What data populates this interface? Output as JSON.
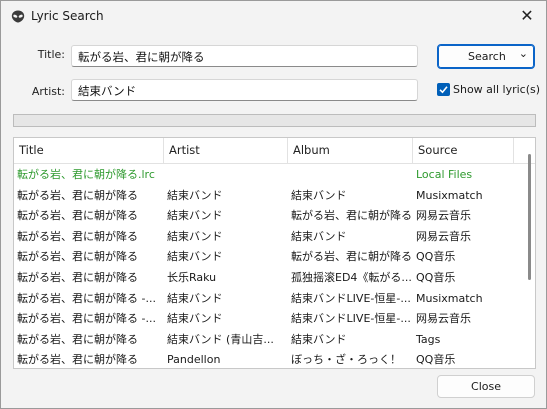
{
  "window": {
    "title": "Lyric Search",
    "close_glyph": "✕",
    "icon": "alien-icon"
  },
  "form": {
    "title_label": "Title:",
    "title_value": "転がる岩、君に朝が降る",
    "artist_label": "Artist:",
    "artist_value": "結束バンド",
    "search_label": "Search",
    "search_dropdown_glyph": "⌄",
    "show_all_label": "Show all lyric(s)",
    "show_all_checked": true
  },
  "progress": {
    "value": 0
  },
  "table": {
    "columns": [
      "Title",
      "Artist",
      "Album",
      "Source"
    ],
    "rows": [
      {
        "title": "転がる岩、君に朝が降る.lrc",
        "artist": "",
        "album": "",
        "source": "Local Files",
        "local": true
      },
      {
        "title": "転がる岩、君に朝が降る",
        "artist": "結束バンド",
        "album": "結束バンド",
        "source": "Musixmatch",
        "local": false
      },
      {
        "title": "転がる岩、君に朝が降る",
        "artist": "結束バンド",
        "album": "転がる岩、君に朝が降る",
        "source": "网易云音乐",
        "local": false
      },
      {
        "title": "転がる岩、君に朝が降る",
        "artist": "結束バンド",
        "album": "結束バンド",
        "source": "网易云音乐",
        "local": false
      },
      {
        "title": "転がる岩、君に朝が降る",
        "artist": "結束バンド",
        "album": "転がる岩、君に朝が降る",
        "source": "QQ音乐",
        "local": false
      },
      {
        "title": "転がる岩、君に朝が降る",
        "artist": "长乐Raku",
        "album": "孤独摇滚ED4《転がる...",
        "source": "QQ音乐",
        "local": false
      },
      {
        "title": "転がる岩、君に朝が降る -...",
        "artist": "結束バンド",
        "album": "結束バンドLIVE-恒星-...",
        "source": "Musixmatch",
        "local": false
      },
      {
        "title": "転がる岩、君に朝が降る -...",
        "artist": "結束バンド",
        "album": "結束バンドLIVE-恒星-...",
        "source": "网易云音乐",
        "local": false
      },
      {
        "title": "転がる岩、君に朝が降る",
        "artist": "結束バンド (青山吉...",
        "album": "結束バンド",
        "source": "Tags",
        "local": false
      },
      {
        "title": "転がる岩、君に朝が降る",
        "artist": "Pandellon",
        "album": "ぼっち・ざ・ろっく！",
        "source": "QQ音乐",
        "local": false
      }
    ]
  },
  "footer": {
    "close_label": "Close"
  },
  "colors": {
    "accent": "#005fb8",
    "local_file": "#2e9a2e"
  }
}
